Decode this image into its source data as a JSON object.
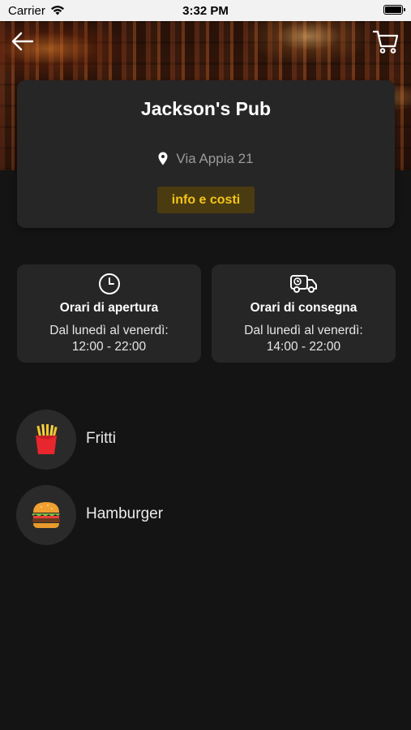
{
  "status_bar": {
    "carrier": "Carrier",
    "time": "3:32 PM"
  },
  "header": {
    "back_icon": "arrow-left-icon",
    "cart_icon": "cart-icon"
  },
  "restaurant": {
    "name": "Jackson's Pub",
    "address": "Via Appia 21",
    "info_button_label": "info e costi",
    "accent_color": "#f5c518"
  },
  "hours": [
    {
      "icon": "clock-icon",
      "title": "Orari di apertura",
      "days": "Dal lunedì al venerdì:",
      "time": "12:00 - 22:00"
    },
    {
      "icon": "delivery-truck-icon",
      "title": "Orari di consegna",
      "days": "Dal lunedì al venerdì:",
      "time": "14:00 - 22:00"
    }
  ],
  "categories": [
    {
      "icon": "fries-icon",
      "label": "Fritti"
    },
    {
      "icon": "hamburger-icon",
      "label": "Hamburger"
    }
  ]
}
